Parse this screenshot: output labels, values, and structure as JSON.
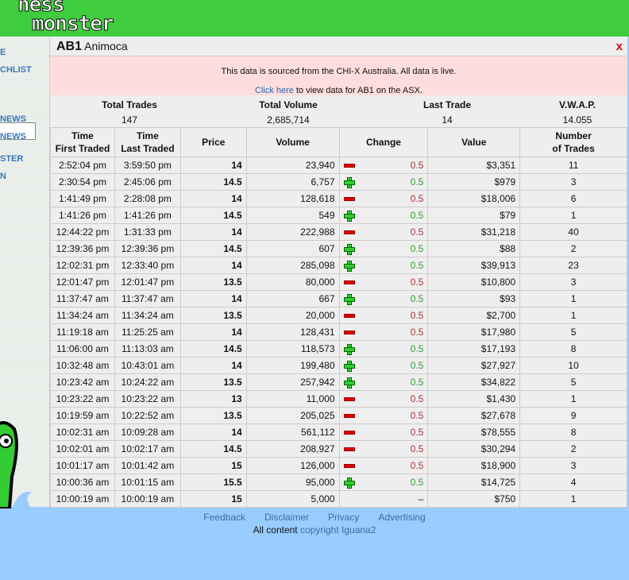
{
  "logo": {
    "line1": "ness",
    "line2": "monster"
  },
  "sidebar": {
    "items": [
      "E",
      "CHLIST",
      "NEWS",
      "NEWS",
      "STER",
      "N"
    ]
  },
  "stock": {
    "code": "AB1",
    "name": "Animoca",
    "close": "x"
  },
  "notice": {
    "line1": "This data is sourced from the CHI-X Australia. All data is live.",
    "link": "Click here",
    "line2": " to view data for AB1 on the ASX."
  },
  "summary": [
    {
      "label": "Total Trades",
      "value": "147"
    },
    {
      "label": "Total Volume",
      "value": "2,685,714"
    },
    {
      "label": "Last Trade",
      "value": "14"
    },
    {
      "label": "V.W.A.P.",
      "value": "14.055"
    }
  ],
  "columns": [
    "Time First Traded",
    "Time Last Traded",
    "Price",
    "Volume",
    "Change",
    "Value",
    "Number of Trades"
  ],
  "rows": [
    [
      "2:52:04 pm",
      "3:59:50 pm",
      "14",
      "23,940",
      "down",
      "0.5",
      "$3,351",
      "11"
    ],
    [
      "2:30:54 pm",
      "2:45:06 pm",
      "14.5",
      "6,757",
      "up",
      "0.5",
      "$979",
      "3"
    ],
    [
      "1:41:49 pm",
      "2:28:08 pm",
      "14",
      "128,618",
      "down",
      "0.5",
      "$18,006",
      "6"
    ],
    [
      "1:41:26 pm",
      "1:41:26 pm",
      "14.5",
      "549",
      "up",
      "0.5",
      "$79",
      "1"
    ],
    [
      "12:44:22 pm",
      "1:31:33 pm",
      "14",
      "222,988",
      "down",
      "0.5",
      "$31,218",
      "40"
    ],
    [
      "12:39:36 pm",
      "12:39:36 pm",
      "14.5",
      "607",
      "up",
      "0.5",
      "$88",
      "2"
    ],
    [
      "12:02:31 pm",
      "12:33:40 pm",
      "14",
      "285,098",
      "up",
      "0.5",
      "$39,913",
      "23"
    ],
    [
      "12:01:47 pm",
      "12:01:47 pm",
      "13.5",
      "80,000",
      "down",
      "0.5",
      "$10,800",
      "3"
    ],
    [
      "11:37:47 am",
      "11:37:47 am",
      "14",
      "667",
      "up",
      "0.5",
      "$93",
      "1"
    ],
    [
      "11:34:24 am",
      "11:34:24 am",
      "13.5",
      "20,000",
      "down",
      "0.5",
      "$2,700",
      "1"
    ],
    [
      "11:19:18 am",
      "11:25:25 am",
      "14",
      "128,431",
      "down",
      "0.5",
      "$17,980",
      "5"
    ],
    [
      "11:06:00 am",
      "11:13:03 am",
      "14.5",
      "118,573",
      "up",
      "0.5",
      "$17,193",
      "8"
    ],
    [
      "10:32:48 am",
      "10:43:01 am",
      "14",
      "199,480",
      "up",
      "0.5",
      "$27,927",
      "10"
    ],
    [
      "10:23:42 am",
      "10:24:22 am",
      "13.5",
      "257,942",
      "up",
      "0.5",
      "$34,822",
      "5"
    ],
    [
      "10:23:22 am",
      "10:23:22 am",
      "13",
      "11,000",
      "down",
      "0.5",
      "$1,430",
      "1"
    ],
    [
      "10:19:59 am",
      "10:22:52 am",
      "13.5",
      "205,025",
      "down",
      "0.5",
      "$27,678",
      "9"
    ],
    [
      "10:02:31 am",
      "10:09:28 am",
      "14",
      "561,112",
      "down",
      "0.5",
      "$78,555",
      "8"
    ],
    [
      "10:02:01 am",
      "10:02:17 am",
      "14.5",
      "208,927",
      "down",
      "0.5",
      "$30,294",
      "2"
    ],
    [
      "10:01:17 am",
      "10:01:42 am",
      "15",
      "126,000",
      "down",
      "0.5",
      "$18,900",
      "3"
    ],
    [
      "10:00:36 am",
      "10:01:15 am",
      "15.5",
      "95,000",
      "up",
      "0.5",
      "$14,725",
      "4"
    ],
    [
      "10:00:19 am",
      "10:00:19 am",
      "15",
      "5,000",
      "none",
      "–",
      "$750",
      "1"
    ]
  ],
  "footer": {
    "links": [
      "Feedback",
      "Disclaimer",
      "Privacy",
      "Advertising"
    ],
    "text": "All content ",
    "copyright": "copyright Iguana2"
  }
}
